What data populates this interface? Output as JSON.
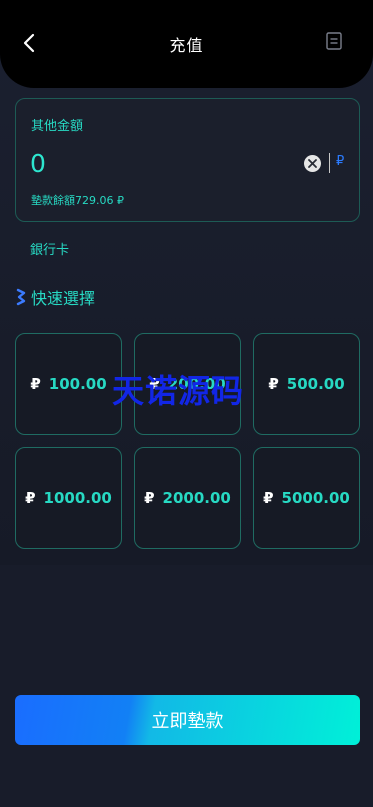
{
  "header": {
    "title": "充值",
    "back_icon": "chevron-left-icon",
    "record_icon": "document-icon"
  },
  "amount_card": {
    "label": "其他金額",
    "value": "0",
    "clear_icon": "close-circle-icon",
    "currency": "₽",
    "balance_text": "墊款餘額729.06 ₽"
  },
  "bank": {
    "label": "銀行卡"
  },
  "quick": {
    "title": "快速選擇",
    "icon": "sparkle-icon",
    "options": [
      {
        "sign": "₽",
        "value": "100.00"
      },
      {
        "sign": "₽",
        "value": "200.00"
      },
      {
        "sign": "₽",
        "value": "500.00"
      },
      {
        "sign": "₽",
        "value": "1000.00"
      },
      {
        "sign": "₽",
        "value": "2000.00"
      },
      {
        "sign": "₽",
        "value": "5000.00"
      }
    ]
  },
  "watermark": "天诺源码",
  "submit": {
    "label": "立即墊款"
  },
  "colors": {
    "accent": "#27d9c3",
    "currency_blue": "#2b7bff",
    "button_start": "#1a6dff",
    "button_end": "#00f0d8",
    "watermark": "#1226e6"
  }
}
